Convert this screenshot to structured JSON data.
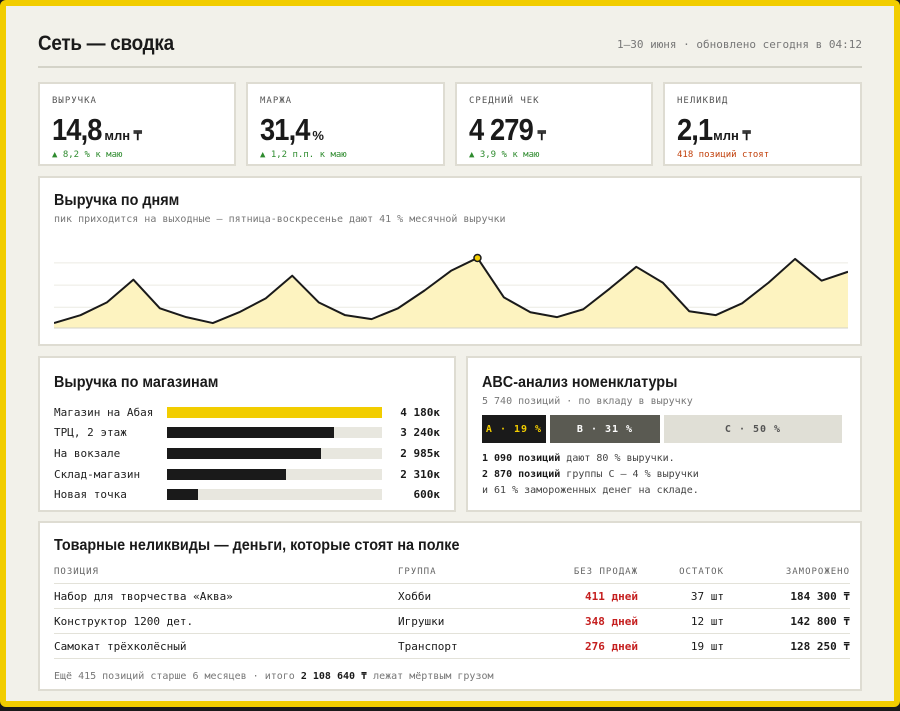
{
  "header": {
    "title": "Сеть — сводка",
    "meta": "1–30 июня · обновлено сегодня в 04:12"
  },
  "kpis": [
    {
      "label": "Выручка",
      "value": "14,8",
      "unit": "млн ₸",
      "note": "▲ 8,2 % к маю",
      "tone": "green"
    },
    {
      "label": "Маржа",
      "value": "31,4",
      "unit": "%",
      "note": "▲ 1,2 п.п. к маю",
      "tone": "green"
    },
    {
      "label": "Средний чек",
      "value": "4 279",
      "unit": "₸",
      "note": "▲ 3,9 % к маю",
      "tone": "green"
    },
    {
      "label": "Неликвид",
      "value": "2,1",
      "unit": "млн ₸",
      "note": "418 позиций стоят",
      "tone": "red"
    }
  ],
  "daily": {
    "title": "Выручка по дням",
    "subtitle": "пик приходится на выходные — пятница-воскресенье дают 41 % месячной выручки",
    "chart_data": {
      "type": "area",
      "x": [
        1,
        2,
        3,
        4,
        5,
        6,
        7,
        8,
        9,
        10,
        11,
        12,
        13,
        14,
        15,
        16,
        17,
        18,
        19,
        20,
        21,
        22,
        23,
        24,
        25,
        26,
        27,
        28,
        29,
        30,
        31
      ],
      "values": [
        5,
        13,
        26,
        49,
        20,
        11,
        5,
        16,
        30,
        53,
        26,
        13,
        9,
        20,
        38,
        58,
        71,
        31,
        16,
        11,
        19,
        40,
        62,
        46,
        17,
        13,
        25,
        46,
        70,
        48,
        57
      ],
      "highlight_index": 16,
      "color": "#1a1a1a",
      "fill": "#fdf3c0",
      "grid": true
    }
  },
  "stores": {
    "title": "Выручка по магазинам",
    "items": [
      {
        "name": "Магазин на Абая",
        "value": "4 180к",
        "amount": 4180,
        "highlight": true
      },
      {
        "name": "ТРЦ, 2 этаж",
        "value": "3 240к",
        "amount": 3240,
        "highlight": false
      },
      {
        "name": "На вокзале",
        "value": "2 985к",
        "amount": 2985,
        "highlight": false
      },
      {
        "name": "Склад-магазин",
        "value": "2 310к",
        "amount": 2310,
        "highlight": false
      },
      {
        "name": "Новая точка",
        "value": "600к",
        "amount": 600,
        "highlight": false
      }
    ]
  },
  "abc": {
    "title": "ABC-анализ номенклатуры",
    "subtitle": "5 740 позиций · по вкладу в выручку",
    "segments": [
      {
        "label": "A · 19 %",
        "share": 19,
        "bg": "#1a1a1a",
        "fg": "#f2cd00"
      },
      {
        "label": "B · 31 %",
        "share": 31,
        "bg": "#5a5a52",
        "fg": "#ffffff"
      },
      {
        "label": "C · 50 %",
        "share": 50,
        "bg": "#e0dfd6",
        "fg": "#555555"
      }
    ],
    "line1_bold": "1 090 позиций",
    "line1_rest": " дают 80 % выручки.",
    "line2_bold": "2 870 позиций",
    "line2_rest": " группы C — 4 % выручки",
    "line3": "и 61 % замороженных денег на складе."
  },
  "deadstock": {
    "title": "Товарные неликвиды — деньги, которые стоят на полке",
    "columns": {
      "position": "Позиция",
      "group": "Группа",
      "no_sales": "Без продаж",
      "stock": "Остаток",
      "frozen": "Заморожено"
    },
    "rows": [
      {
        "position": "Набор для творчества «Аква»",
        "group": "Хобби",
        "no_sales": "411 дней",
        "stock": "37 шт",
        "frozen": "184 300 ₸"
      },
      {
        "position": "Конструктор 1200 дет.",
        "group": "Игрушки",
        "no_sales": "348 дней",
        "stock": "12 шт",
        "frozen": "142 800 ₸"
      },
      {
        "position": "Самокат трёхколёсный",
        "group": "Транспорт",
        "no_sales": "276 дней",
        "stock": "19 шт",
        "frozen": "128 250 ₸"
      }
    ],
    "footer_pre": "Ещё 415 позиций старше 6 месяцев · итого ",
    "footer_bold": "2 108 640 ₸",
    "footer_post": " лежат мёртвым грузом"
  }
}
